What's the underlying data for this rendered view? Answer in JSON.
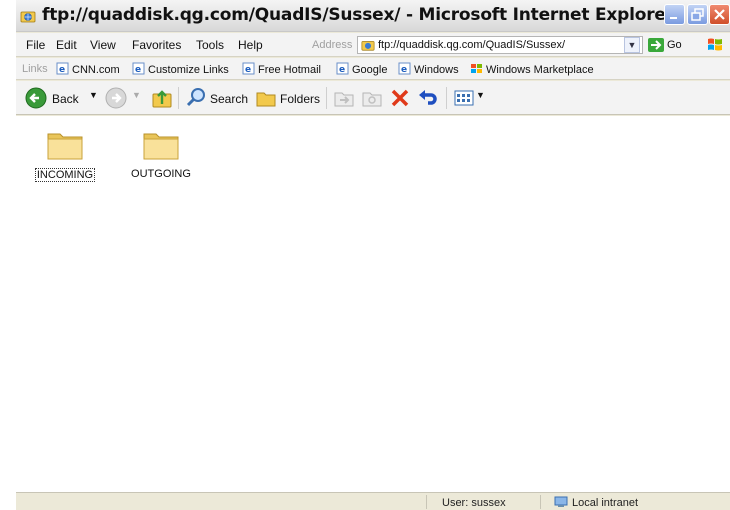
{
  "window": {
    "title": "ftp://quaddisk.qg.com/QuadIS/Sussex/ - Microsoft Internet Explorer"
  },
  "menu": {
    "items": [
      {
        "label": "File"
      },
      {
        "label": "Edit"
      },
      {
        "label": "View"
      },
      {
        "label": "Favorites"
      },
      {
        "label": "Tools"
      },
      {
        "label": "Help"
      }
    ]
  },
  "address": {
    "label": "Address",
    "value": "ftp://quaddisk.qg.com/QuadIS/Sussex/",
    "go_label": "Go"
  },
  "links": {
    "label": "Links",
    "items": [
      {
        "label": "CNN.com",
        "icon": "ie-page-icon"
      },
      {
        "label": "Customize Links",
        "icon": "ie-page-icon"
      },
      {
        "label": "Free Hotmail",
        "icon": "ie-page-icon"
      },
      {
        "label": "Google",
        "icon": "ie-page-icon"
      },
      {
        "label": "Windows",
        "icon": "ie-page-icon"
      },
      {
        "label": "Windows Marketplace",
        "icon": "windows-flag-icon"
      }
    ]
  },
  "toolbar": {
    "back_label": "Back",
    "search_label": "Search",
    "folders_label": "Folders"
  },
  "content": {
    "folders": [
      {
        "name": "INCOMING",
        "selected": true
      },
      {
        "name": "OUTGOING",
        "selected": false
      }
    ]
  },
  "status": {
    "user": "User: sussex",
    "zone": "Local intranet"
  },
  "colors": {
    "folder_fill": "#f9e19a",
    "close_button": "#d04f2a",
    "caption_button": "#7a9be0"
  }
}
